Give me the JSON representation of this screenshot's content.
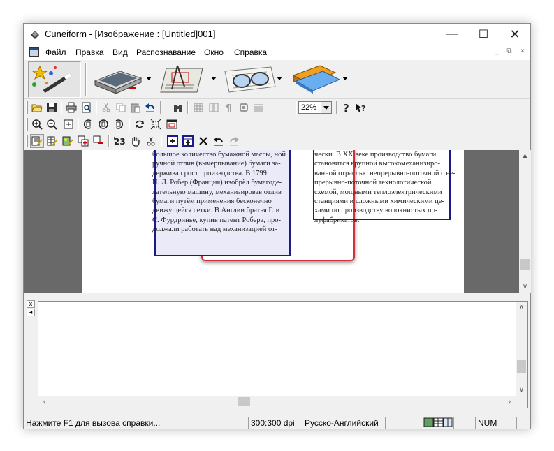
{
  "window": {
    "title": "Cuneiform - [Изображение : [Untitled]001]",
    "controls": {
      "minimize": "—",
      "maximize": "☐",
      "close": "✕"
    }
  },
  "menu": {
    "items": [
      "Файл",
      "Правка",
      "Вид",
      "Распознавание",
      "Окно",
      "Справка"
    ],
    "mdi_controls": [
      "_",
      "⧉",
      "×"
    ]
  },
  "big_toolbar": {
    "buttons": [
      "magic-wand",
      "scanner",
      "layout-edit",
      "glasses-recognize",
      "save-book"
    ]
  },
  "toolbar": {
    "zoom": "22%"
  },
  "page_columns": {
    "left": [
      "большое количество бумажной массы, ной",
      "ручной отлив (вычерпывание) бумаги за-",
      "держивал рост производства. В 1799",
      "Н. Л. Робер (Франция) изобрёл бумагоде-",
      "лательную машину, механизировав отлив",
      "бумаги путём применения бесконечно",
      "движущейся сетки. В Англии братья Г. и",
      "С. Фурдринье, купив патент Робера, про-",
      "должали работать над механизацией от-"
    ],
    "right": [
      "чески. В XX веке производство бумаги",
      "становится крупной высокомеханизиро-",
      "ванной отраслью непрерывно-поточной с не-",
      "прерывно-поточной технологической",
      "схемой, мощными теплоэлектрическими",
      "станциями и сложными химическими це-",
      "хами по производству волокнистых по-",
      "луфабрикатов."
    ]
  },
  "text_pane": {
    "side_buttons": [
      "x",
      "◂"
    ]
  },
  "status": {
    "help": "Нажмите F1 для вызова справки...",
    "dpi": "300:300 dpi",
    "language": "Русско-Английский",
    "num": "NUM"
  },
  "colors": {
    "image_background": "#696969",
    "block_frame": "#1a1a8a",
    "highlight": "#d4303a"
  }
}
